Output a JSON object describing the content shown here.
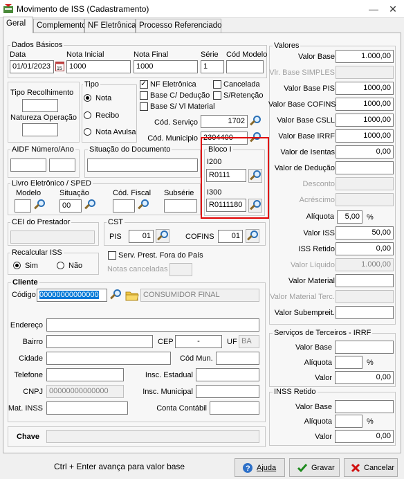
{
  "window": {
    "title": "Movimento de ISS (Cadastramento)",
    "minimize": "—",
    "close": "✕"
  },
  "tabs": [
    "Geral",
    "Complemento",
    "NF Eletrônica",
    "Processo Referenciado"
  ],
  "dados_basicos": {
    "title": "Dados Básicos",
    "data_label": "Data",
    "data_value": "01/01/2023",
    "nota_inicial_label": "Nota Inicial",
    "nota_inicial_value": "1000",
    "nota_final_label": "Nota Final",
    "nota_final_value": "1000",
    "serie_label": "Série",
    "serie_value": "1",
    "cod_modelo_label": "Cód Modelo",
    "cod_modelo_value": ""
  },
  "tipo_recolhimento_label": "Tipo Recolhimento",
  "natureza_operacao_label": "Natureza Operação",
  "tipo": {
    "title": "Tipo",
    "options": [
      "Nota",
      "Recibo",
      "Nota Avulsa"
    ],
    "selected": "Nota"
  },
  "flags": {
    "nf_eletronica": "NF Eletrônica",
    "cancelada": "Cancelada",
    "base_c_deducao": "Base C/ Dedução",
    "s_retencao": "S/Retenção",
    "base_s_vl_material": "Base S/ Vl Material"
  },
  "cod_servico": {
    "label": "Cód. Serviço",
    "value": "1702"
  },
  "cod_municipio": {
    "label": "Cód. Municipio",
    "value": "2304400"
  },
  "bloco_i": {
    "title": "Bloco I",
    "i200_label": "I200",
    "i200_value": "R0111",
    "i300_label": "I300",
    "i300_value": "R0111180"
  },
  "aidf": {
    "title": "AIDF Número/Ano"
  },
  "situacao_documento": {
    "title": "Situação do Documento"
  },
  "livro": {
    "title": "Livro Eletrônico / SPED",
    "modelo_label": "Modelo",
    "situacao_label": "Situação",
    "situacao_value": "00",
    "cod_fiscal_label": "Cód. Fiscal",
    "subserie_label": "Subsérie"
  },
  "cei": {
    "title": "CEI do Prestador"
  },
  "cst": {
    "title": "CST",
    "pis_label": "PIS",
    "pis_value": "01",
    "cofins_label": "COFINS",
    "cofins_value": "01"
  },
  "recalcular": {
    "title": "Recalcular ISS",
    "sim": "Sim",
    "nao": "Não"
  },
  "serv_prest": "Serv. Prest. Fora do País",
  "notas_canceladas": "Notas canceladas",
  "cliente": {
    "title": "Cliente",
    "codigo_label": "Código",
    "codigo_value": "00000000000000",
    "nome_value": "CONSUMIDOR FINAL",
    "endereco_label": "Endereço",
    "bairro_label": "Bairro",
    "cep_label": "CEP",
    "cep_value": "-",
    "uf_label": "UF",
    "uf_value": "BA",
    "cidade_label": "Cidade",
    "cod_mun_label": "Cód Mun.",
    "telefone_label": "Telefone",
    "insc_estadual_label": "Insc. Estadual",
    "cnpj_label": "CNPJ",
    "cnpj_value": "00000000000000",
    "insc_municipal_label": "Insc. Municipal",
    "mat_inss_label": "Mat. INSS",
    "conta_contabil_label": "Conta Contábil"
  },
  "chave_label": "Chave",
  "valores": {
    "title": "Valores",
    "rows": [
      {
        "label": "Valor Base",
        "value": "1.000,00",
        "disabled": false
      },
      {
        "label": "Vlr. Base SIMPLES",
        "value": "",
        "disabled": true
      },
      {
        "label": "Valor Base PIS",
        "value": "1000,00",
        "disabled": false
      },
      {
        "label": "Valor Base COFINS",
        "value": "1000,00",
        "disabled": false
      },
      {
        "label": "Valor Base CSLL",
        "value": "1000,00",
        "disabled": false
      },
      {
        "label": "Valor Base IRRF",
        "value": "1000,00",
        "disabled": false
      },
      {
        "label": "Valor de Isentas",
        "value": "0,00",
        "disabled": false
      },
      {
        "label": "Valor de Dedução",
        "value": "",
        "disabled": false
      },
      {
        "label": "Desconto",
        "value": "",
        "disabled": true
      },
      {
        "label": "Acréscimo",
        "value": "",
        "disabled": true
      }
    ],
    "aliquota_label": "Alíquota",
    "aliquota_value": "5,00",
    "percent": "%",
    "rows2": [
      {
        "label": "Valor ISS",
        "value": "50,00",
        "disabled": false
      },
      {
        "label": "ISS Retido",
        "value": "0,00",
        "disabled": false
      },
      {
        "label": "Valor Líquido",
        "value": "1.000,00",
        "disabled": true
      },
      {
        "label": "Valor Material",
        "value": "",
        "disabled": false
      },
      {
        "label": "Valor Material Terc.",
        "value": "",
        "disabled": true
      },
      {
        "label": "Valor Subempreit.",
        "value": "",
        "disabled": false
      }
    ]
  },
  "terceiros": {
    "title": "Serviços de Terceiros - IRRF",
    "valor_base": "Valor Base",
    "aliquota": "Alíquota",
    "percent": "%",
    "valor": "Valor",
    "valor_value": "0,00"
  },
  "inss": {
    "title": "INSS Retido",
    "valor_base": "Valor Base",
    "aliquota": "Alíquota",
    "percent": "%",
    "valor": "Valor",
    "valor_value": "0,00"
  },
  "footer": {
    "hint": "Ctrl + Enter avança para valor base",
    "ajuda": "Ajuda",
    "gravar": "Gravar",
    "cancelar": "Cancelar"
  }
}
